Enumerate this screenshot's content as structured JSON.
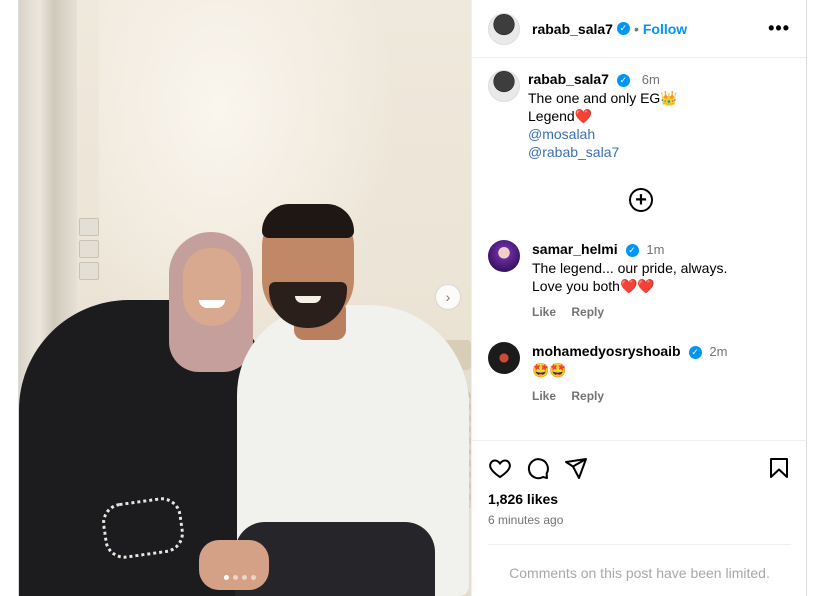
{
  "post": {
    "author": "rabab_sala7",
    "follow_label": "Follow",
    "separator": "•",
    "more_label": "•••",
    "caption_lines": [
      "The one and only EG👑",
      "Legend❤️"
    ],
    "mentions": [
      "@mosalah",
      "@rabab_sala7"
    ],
    "caption_time": "6m",
    "likes": "1,826 likes",
    "time_ago": "6 minutes ago",
    "limited_notice": "Comments on this post have been limited.",
    "next_label": "›",
    "add_label": "+"
  },
  "comments": [
    {
      "user": "samar_helmi",
      "time": "1m",
      "lines": [
        "The legend... our pride, always.",
        "Love you both❤️❤️"
      ],
      "like_label": "Like",
      "reply_label": "Reply"
    },
    {
      "user": "mohamedyosryshoaib",
      "time": "2m",
      "lines": [
        "🤩🤩"
      ],
      "like_label": "Like",
      "reply_label": "Reply"
    }
  ],
  "colors": {
    "accent": "#0095f6",
    "muted": "#737373",
    "mention": "#3b6fb6"
  },
  "icons": [
    "heart-icon",
    "comment-icon",
    "share-icon",
    "bookmark-icon",
    "verified-icon",
    "more-icon",
    "add-circle-icon",
    "chevron-right-icon"
  ]
}
